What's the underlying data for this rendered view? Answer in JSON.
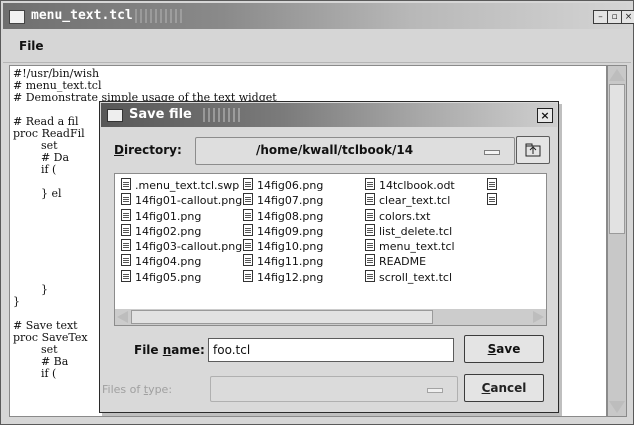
{
  "main_window": {
    "title": "menu_text.tcl",
    "buttons": {
      "minimize": "–",
      "maximize": "▫",
      "close": "×"
    }
  },
  "menubar": {
    "file": "File"
  },
  "code": {
    "lines": [
      "#!/usr/bin/wish",
      "# menu_text.tcl",
      "# Demonstrate simple usage of the text widget",
      "",
      "# Read a fil",
      "proc ReadFil",
      "        set ",
      "        # Da",
      "        if (",
      "",
      "        } el",
      "",
      "",
      "",
      "",
      "",
      "",
      "",
      "        }",
      "}",
      "",
      "# Save text",
      "proc SaveTex",
      "        set ",
      "        # Ba",
      "        if ("
    ]
  },
  "dialog": {
    "title": "Save file",
    "close": "×",
    "directory_label_prefix": "D",
    "directory_label_rest": "irectory:",
    "directory_value": "/home/kwall/tclbook/14",
    "files": {
      "col1": [
        ".menu_text.tcl.swp",
        "14fig01-callout.png",
        "14fig01.png",
        "14fig02.png",
        "14fig03-callout.png",
        "14fig04.png",
        "14fig05.png"
      ],
      "col2": [
        "14fig06.png",
        "14fig07.png",
        "14fig08.png",
        "14fig09.png",
        "14fig10.png",
        "14fig11.png",
        "14fig12.png"
      ],
      "col3": [
        "14tclbook.odt",
        "clear_text.tcl",
        "colors.txt",
        "list_delete.tcl",
        "menu_text.tcl",
        "README",
        "scroll_text.tcl"
      ],
      "col4": [
        "",
        ""
      ]
    },
    "filename_label_prefix": "File ",
    "filename_label_u": "n",
    "filename_label_rest": "ame:",
    "filename_value": "foo.tcl",
    "save_u": "S",
    "save_rest": "ave",
    "filetype_label_prefix": "Files of ",
    "filetype_label_u": "t",
    "filetype_label_rest": "ype:",
    "cancel_u": "C",
    "cancel_rest": "ancel"
  }
}
